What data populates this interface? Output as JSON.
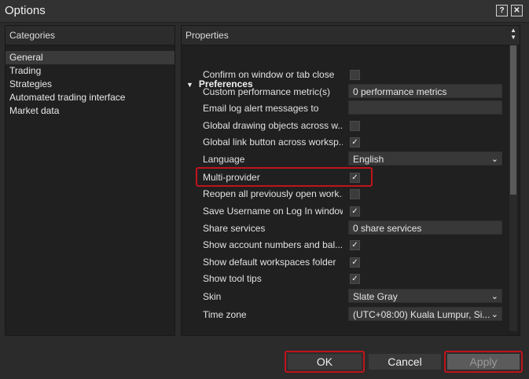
{
  "window": {
    "title": "Options",
    "help_glyph": "?",
    "close_glyph": "✕"
  },
  "categories": {
    "header": "Categories",
    "items": [
      "General",
      "Trading",
      "Strategies",
      "Automated trading interface",
      "Market data"
    ],
    "selected": "General"
  },
  "properties": {
    "header": "Properties",
    "section": "Preferences",
    "rows": [
      {
        "label": "Confirm on window or tab close",
        "type": "checkbox",
        "checked": false
      },
      {
        "label": "Custom performance metric(s)",
        "type": "text",
        "value": "0 performance metrics"
      },
      {
        "label": "Email log alert messages to",
        "type": "text",
        "value": ""
      },
      {
        "label": "Global drawing objects across w...",
        "type": "checkbox",
        "checked": false
      },
      {
        "label": "Global link button across worksp...",
        "type": "checkbox",
        "checked": true
      },
      {
        "label": "Language",
        "type": "select",
        "value": "English"
      },
      {
        "label": "Multi-provider",
        "type": "checkbox",
        "checked": true
      },
      {
        "label": "Reopen all previously open work...",
        "type": "checkbox",
        "checked": false
      },
      {
        "label": "Save Username on Log In window",
        "type": "checkbox",
        "checked": true
      },
      {
        "label": "Share services",
        "type": "text",
        "value": "0 share services"
      },
      {
        "label": "Show account numbers and bal...",
        "type": "checkbox",
        "checked": true
      },
      {
        "label": "Show default workspaces folder",
        "type": "checkbox",
        "checked": true
      },
      {
        "label": "Show tool tips",
        "type": "checkbox",
        "checked": true
      },
      {
        "label": "Skin",
        "type": "select",
        "value": "Slate Gray"
      },
      {
        "label": "Time zone",
        "type": "select",
        "value": "(UTC+08:00) Kuala Lumpur, Si..."
      }
    ]
  },
  "buttons": {
    "ok": "OK",
    "cancel": "Cancel",
    "apply": "Apply"
  }
}
